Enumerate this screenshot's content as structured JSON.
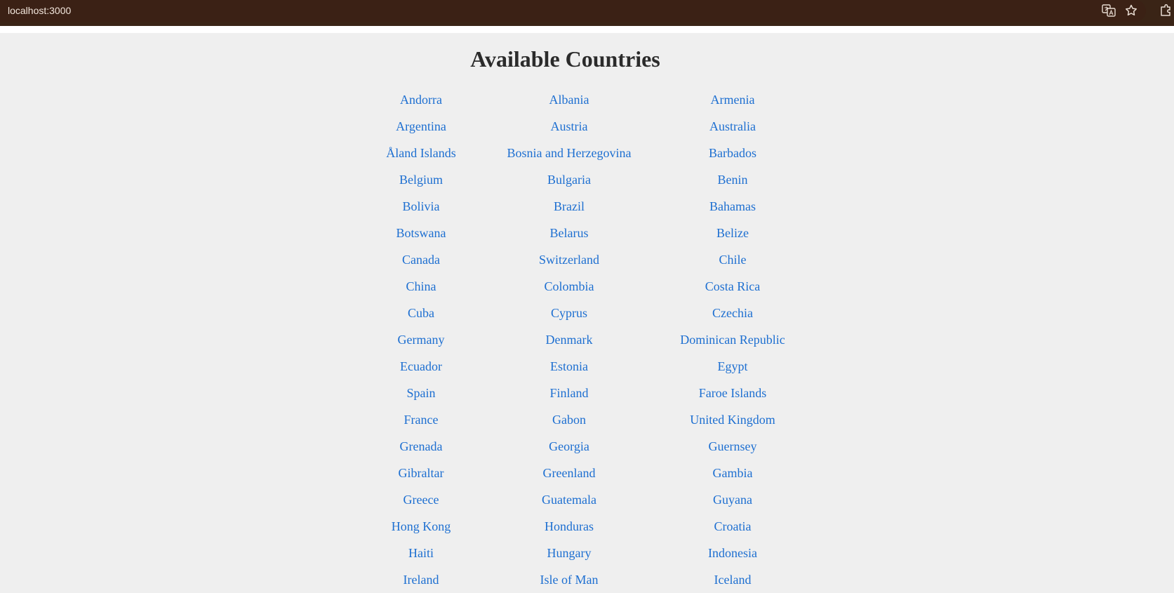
{
  "browser": {
    "url": "localhost:3000",
    "icons": [
      "translate-icon",
      "star-icon",
      "extensions-icon"
    ]
  },
  "page": {
    "title": "Available Countries"
  },
  "countries": [
    "Andorra",
    "Albania",
    "Armenia",
    "Argentina",
    "Austria",
    "Australia",
    "Åland Islands",
    "Bosnia and Herzegovina",
    "Barbados",
    "Belgium",
    "Bulgaria",
    "Benin",
    "Bolivia",
    "Brazil",
    "Bahamas",
    "Botswana",
    "Belarus",
    "Belize",
    "Canada",
    "Switzerland",
    "Chile",
    "China",
    "Colombia",
    "Costa Rica",
    "Cuba",
    "Cyprus",
    "Czechia",
    "Germany",
    "Denmark",
    "Dominican Republic",
    "Ecuador",
    "Estonia",
    "Egypt",
    "Spain",
    "Finland",
    "Faroe Islands",
    "France",
    "Gabon",
    "United Kingdom",
    "Grenada",
    "Georgia",
    "Guernsey",
    "Gibraltar",
    "Greenland",
    "Gambia",
    "Greece",
    "Guatemala",
    "Guyana",
    "Hong Kong",
    "Honduras",
    "Croatia",
    "Haiti",
    "Hungary",
    "Indonesia",
    "Ireland",
    "Isle of Man",
    "Iceland"
  ],
  "colors": {
    "link": "#1d6fd1",
    "title": "#2b2b2b",
    "background": "#efefef",
    "browser_bar": "#3a2416"
  }
}
